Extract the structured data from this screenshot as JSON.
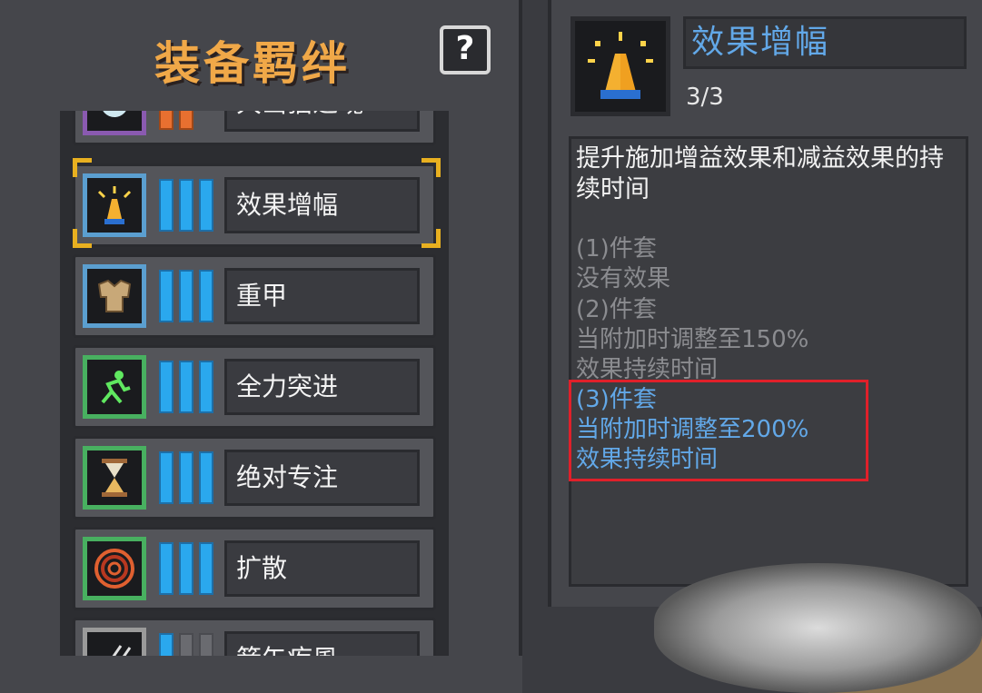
{
  "left": {
    "title": "装备羁绊",
    "help_label": "?",
    "partial_top_name": "大山猫之魂",
    "sets": [
      {
        "name": "效果增幅",
        "border_color": "#5b9fd0",
        "icon": "praying-hands-icon",
        "filled": 3,
        "total": 3,
        "selected": true
      },
      {
        "name": "重甲",
        "border_color": "#5b9fd0",
        "icon": "armor-icon",
        "filled": 3,
        "total": 3,
        "selected": false
      },
      {
        "name": "全力突进",
        "border_color": "#48b060",
        "icon": "sprint-icon",
        "filled": 3,
        "total": 3,
        "selected": false
      },
      {
        "name": "绝对专注",
        "border_color": "#48b060",
        "icon": "hourglass-icon",
        "filled": 3,
        "total": 3,
        "selected": false
      },
      {
        "name": "扩散",
        "border_color": "#48b060",
        "icon": "ripple-icon",
        "filled": 3,
        "total": 3,
        "selected": false
      },
      {
        "name": "箭矢疾風",
        "border_color": "#9a9a9a",
        "icon": "arrows-icon",
        "filled": 1,
        "total": 3,
        "selected": false
      }
    ]
  },
  "detail": {
    "name": "效果增幅",
    "level": "3/3",
    "icon": "praying-hands-icon",
    "description": "提升施加增益效果和减益效果的持续时间",
    "tiers": [
      {
        "header": "(1)件套",
        "lines": [
          "没有效果"
        ],
        "active": false
      },
      {
        "header": "(2)件套",
        "lines": [
          "当附加时调整至150%",
          "效果持续时间"
        ],
        "active": false
      },
      {
        "header": "(3)件套",
        "lines": [
          "当附加时调整至200%",
          "效果持续时间"
        ],
        "active": true
      }
    ]
  },
  "colors": {
    "title": "#f0a848",
    "active_text": "#62a8e8",
    "inactive_text": "#8b8c90",
    "bar_filled": "#2aa8ee",
    "highlight": "#e0202a",
    "selection_corner": "#e8b020"
  }
}
